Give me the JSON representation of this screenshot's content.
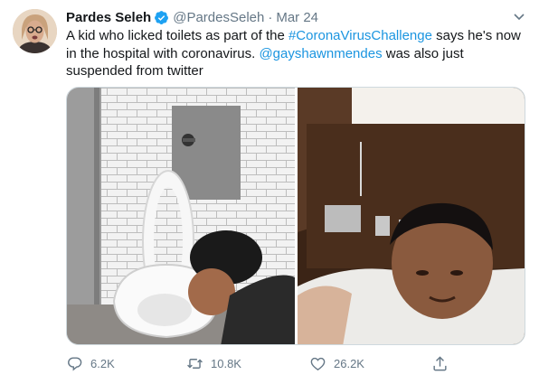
{
  "author": {
    "name": "Pardes Seleh",
    "handle": "@PardesSeleh",
    "separator": "·",
    "date": "Mar 24"
  },
  "tweet": {
    "text_part1": "A kid who licked toilets as part of the ",
    "hashtag": "#CoronaVirusChallenge",
    "text_part2": " says he's now in the hospital with coronavirus. ",
    "mention": "@gayshawnmendes",
    "text_part3": " was also just suspended from twitter"
  },
  "media": {
    "photos": [
      "toilet-photo",
      "hospital-photo"
    ]
  },
  "actions": {
    "replies": "6.2K",
    "retweets": "10.8K",
    "likes": "26.2K"
  },
  "colors": {
    "link": "#1b95e0",
    "muted": "#657786",
    "verified": "#1da1f2"
  }
}
